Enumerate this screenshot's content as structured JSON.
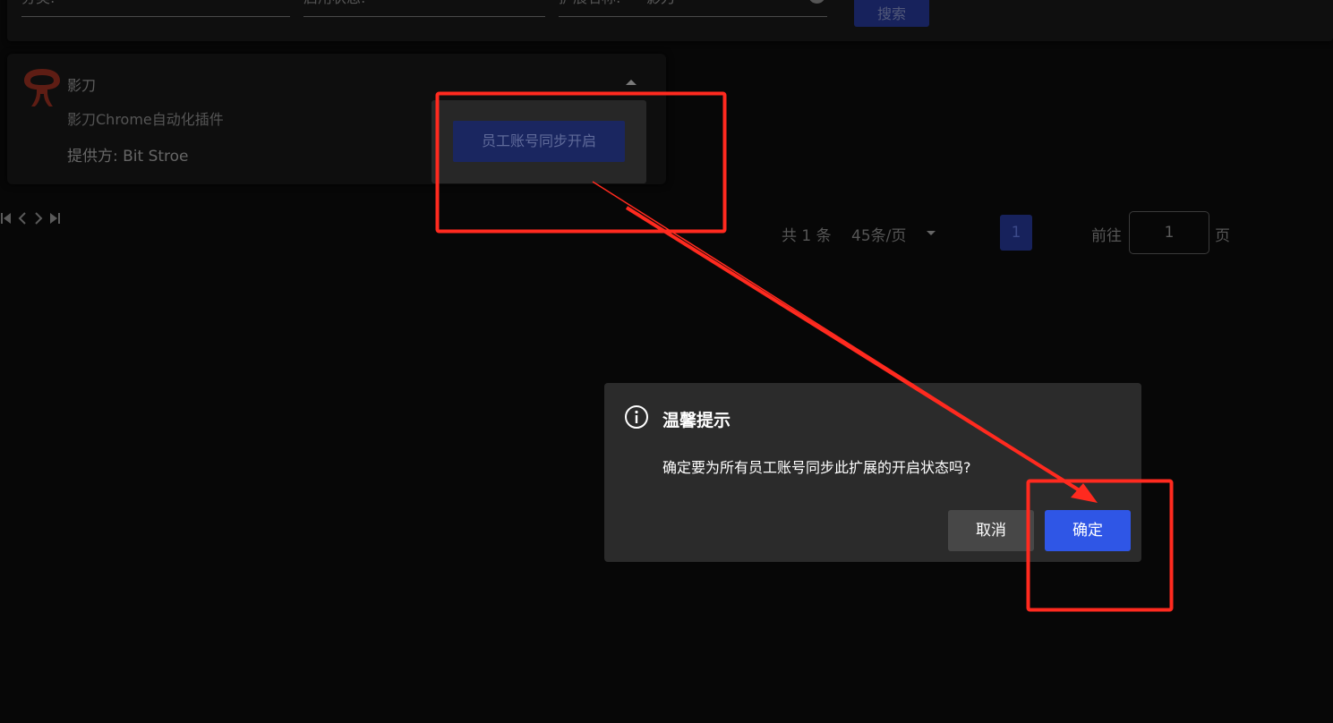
{
  "filters": {
    "category_label": "分类:",
    "status_label": "启用状态:",
    "name_label": "扩展名称:",
    "name_value": "影刀",
    "search_label": "搜索"
  },
  "extension": {
    "name": "影刀",
    "description": "影刀Chrome自动化插件",
    "provider": "提供方:  Bit Stroe"
  },
  "popup": {
    "sync_label": "员工账号同步开启"
  },
  "pagination": {
    "total": "共 1 条",
    "page_size": "45条/页",
    "current_page": "1",
    "goto_label": "前往",
    "goto_value": "1",
    "page_unit": "页"
  },
  "dialog": {
    "title": "温馨提示",
    "message": "确定要为所有员工账号同步此扩展的开启状态吗?",
    "cancel_label": "取消",
    "confirm_label": "确定"
  },
  "colors": {
    "primary": "#2f56e6",
    "annotation": "#ff2a1f",
    "background": "#070707",
    "dialog_bg": "#2b2b2b"
  },
  "icons": {
    "info": "info-circle-icon",
    "logo": "yingdao-logo-icon"
  }
}
